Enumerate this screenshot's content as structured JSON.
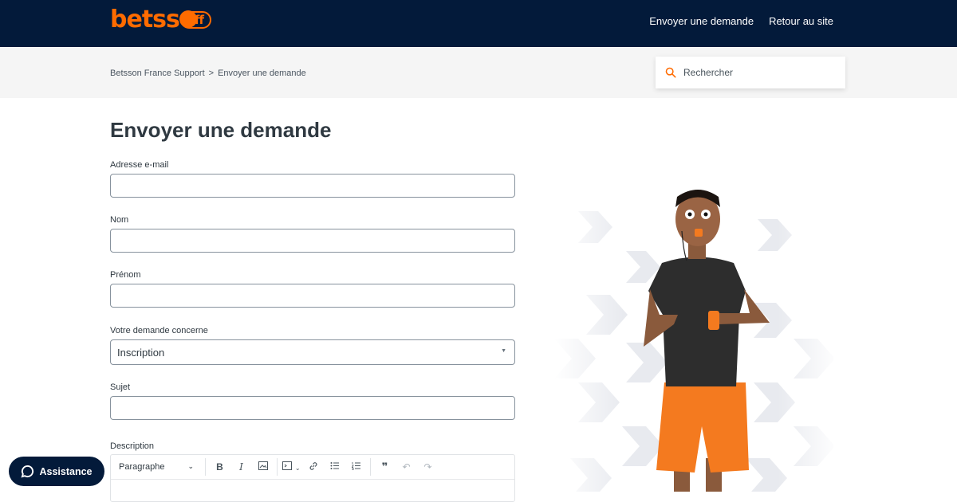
{
  "header": {
    "logo_text": "betss",
    "logo_badge": "ff",
    "nav": [
      {
        "label": "Envoyer une demande"
      },
      {
        "label": "Retour au site"
      }
    ]
  },
  "breadcrumb": {
    "items": [
      "Betsson France Support",
      "Envoyer une demande"
    ],
    "separator": ">"
  },
  "search": {
    "placeholder": "Rechercher",
    "icon": "search-icon"
  },
  "form": {
    "title": "Envoyer une demande",
    "fields": {
      "email": {
        "label": "Adresse e-mail",
        "value": ""
      },
      "nom": {
        "label": "Nom",
        "value": ""
      },
      "prenom": {
        "label": "Prénom",
        "value": ""
      },
      "demande": {
        "label": "Votre demande concerne",
        "value": "Inscription"
      },
      "sujet": {
        "label": "Sujet",
        "value": ""
      },
      "description": {
        "label": "Description"
      }
    },
    "editor": {
      "paragraph_select": "Paragraphe",
      "tools": [
        "bold-icon",
        "italic-icon",
        "image-icon",
        "code-block-icon",
        "link-icon",
        "bulleted-list-icon",
        "numbered-list-icon",
        "quote-icon",
        "undo-icon",
        "redo-icon"
      ]
    }
  },
  "assistance": {
    "label": "Assistance",
    "icon": "chat-bubble-icon"
  },
  "colors": {
    "brand_orange": "#ff6b00",
    "header_navy": "#031a3a",
    "subbar_gray": "#f5f5f5"
  }
}
